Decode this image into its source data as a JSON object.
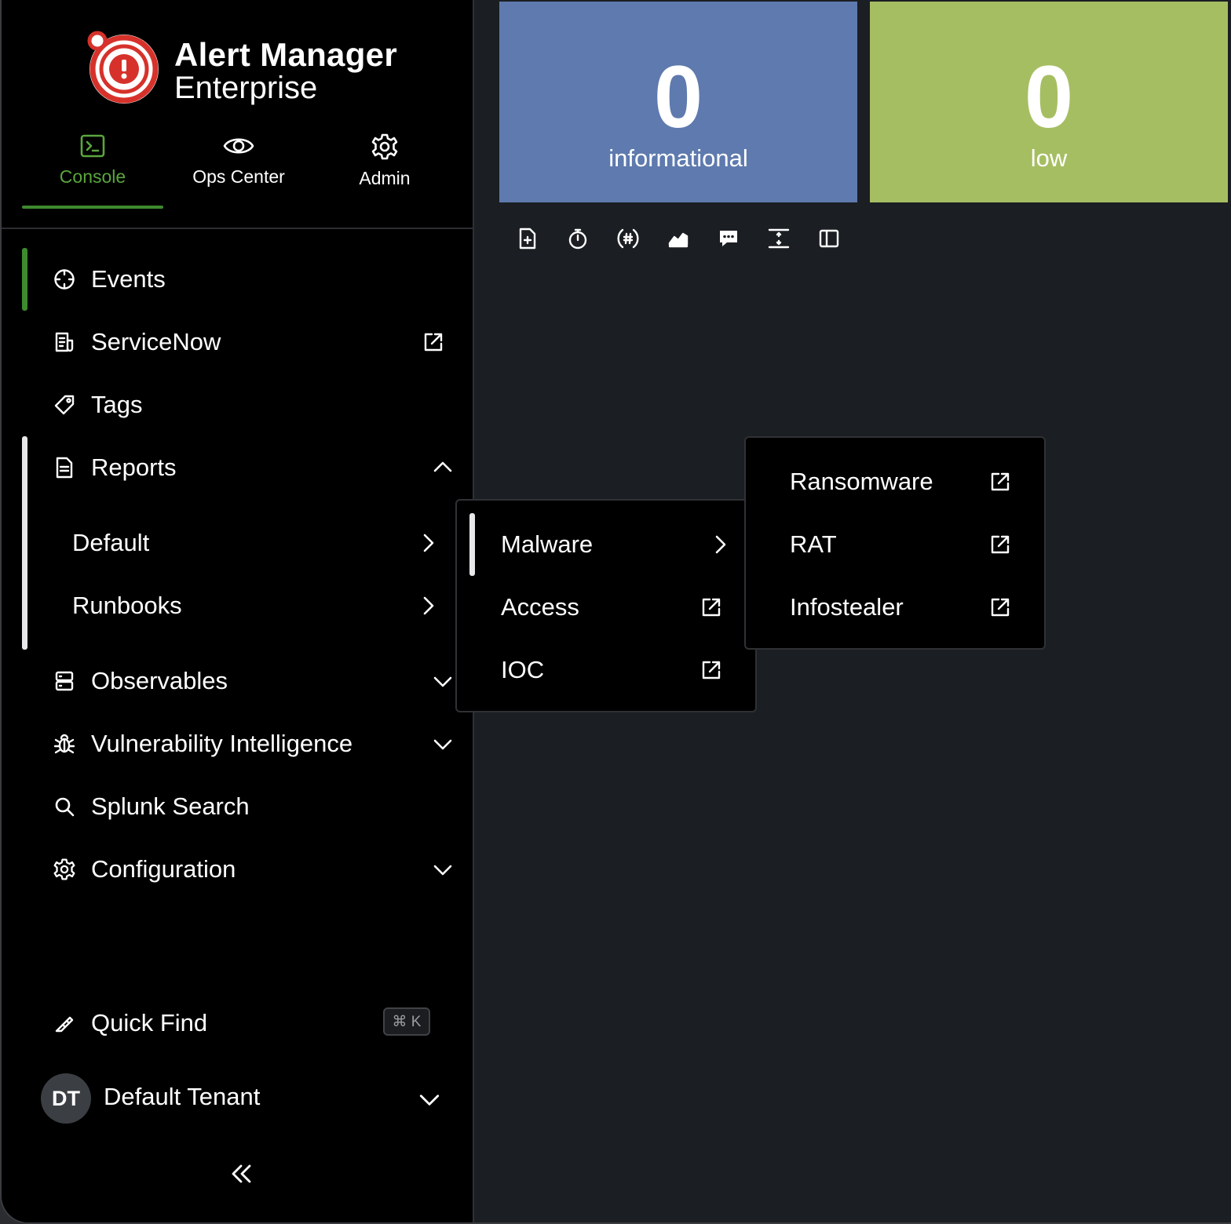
{
  "app": {
    "title_line1": "Alert Manager",
    "title_line2": "Enterprise"
  },
  "topnav": [
    {
      "label": "Console",
      "icon": "terminal-icon",
      "active": true
    },
    {
      "label": "Ops Center",
      "icon": "eye-icon",
      "active": false
    },
    {
      "label": "Admin",
      "icon": "gear-icon",
      "active": false
    }
  ],
  "sidebar": {
    "items": [
      {
        "label": "Events",
        "icon": "crosshair-icon"
      },
      {
        "label": "ServiceNow",
        "icon": "receipt-icon",
        "trail": "external-link-icon"
      },
      {
        "label": "Tags",
        "icon": "tag-icon"
      },
      {
        "label": "Reports",
        "icon": "document-icon",
        "trail": "chevron-up-icon"
      },
      {
        "label": "Observables",
        "icon": "database-icon",
        "trail": "chevron-down-icon"
      },
      {
        "label": "Vulnerability Intelligence",
        "icon": "bug-icon",
        "trail": "chevron-down-icon"
      },
      {
        "label": "Splunk Search",
        "icon": "search-icon"
      },
      {
        "label": "Configuration",
        "icon": "gear-icon",
        "trail": "chevron-down-icon"
      }
    ],
    "reports_children": [
      {
        "label": "Default",
        "trail": "chevron-right-icon"
      },
      {
        "label": "Runbooks",
        "trail": "chevron-right-icon"
      }
    ],
    "quick_find": {
      "label": "Quick Find",
      "shortcut": "⌘ K"
    },
    "tenant": {
      "initials": "DT",
      "label": "Default Tenant"
    }
  },
  "cards": [
    {
      "value": "0",
      "caption": "informational",
      "color": "#5e7aae"
    },
    {
      "value": "0",
      "caption": "low",
      "color": "#a6be62"
    }
  ],
  "colors": {
    "accent": "#3e8a2e",
    "accent_text": "#5aa63d"
  },
  "menu_level2": [
    {
      "label": "Malware",
      "trail": "chevron-right-icon"
    },
    {
      "label": "Access",
      "trail": "external-link-icon"
    },
    {
      "label": "IOC",
      "trail": "external-link-icon"
    }
  ],
  "menu_level3": [
    {
      "label": "Ransomware",
      "trail": "external-link-icon"
    },
    {
      "label": "RAT",
      "trail": "external-link-icon"
    },
    {
      "label": "Infostealer",
      "trail": "external-link-icon"
    }
  ]
}
